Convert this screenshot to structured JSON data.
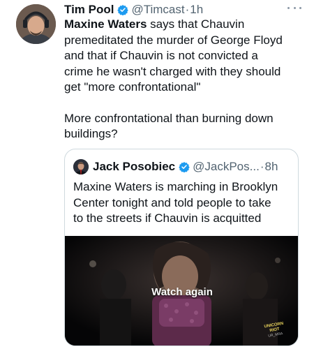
{
  "tweet": {
    "author_name": "Tim Pool",
    "handle": "@Timcast",
    "separator": "·",
    "time": "1h",
    "body_mention": "Maxine Waters",
    "body_lines": [
      " says that Chauvin",
      "premeditated the murder of George Floyd",
      "and that if Chauvin is not convicted a",
      "crime he wasn't charged with they should",
      "get \"more confrontational\""
    ],
    "body_lines_2": [
      "More confrontational than burning down",
      "buildings?"
    ]
  },
  "quoted_tweet": {
    "author_name": "Jack Posobiec",
    "handle": "@JackPos...",
    "separator": "·",
    "time": "8h",
    "text_lines": [
      "Maxine Waters is marching in Brooklyn",
      "Center tonight and told people to take",
      "to the streets if Chauvin is acquitted"
    ],
    "media": {
      "overlay_label": "Watch again",
      "badge_text": "UNICORN RIOT",
      "badge_sub": "UR_MRA"
    }
  },
  "icons": {
    "verified": "verified-badge-icon",
    "more": "more-options-icon"
  },
  "colors": {
    "text": "#0f1419",
    "secondary": "#536471",
    "verified": "#1d9bf0",
    "border": "#cfd9de"
  }
}
